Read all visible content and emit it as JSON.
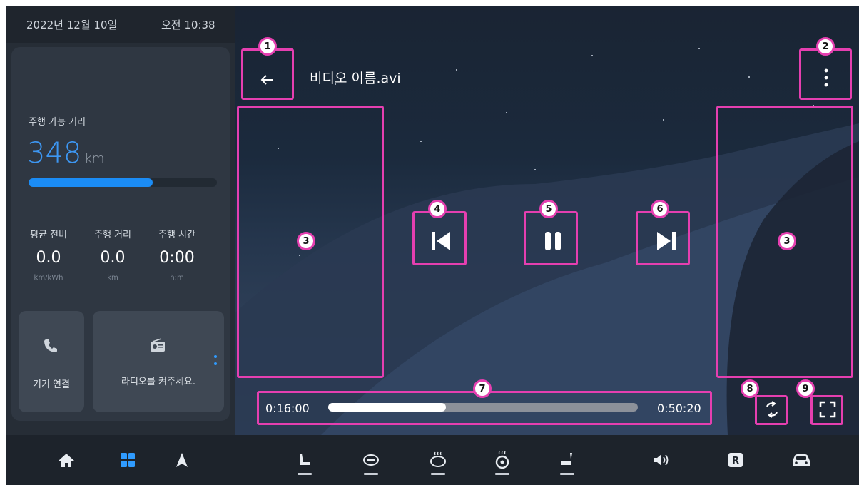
{
  "status_bar": {
    "date": "2022년 12월 10일",
    "time": "오전 10:38",
    "icons": [
      "user-icon",
      "usb-icon",
      "bell-icon",
      "bluetooth-icon",
      "wifi-icon",
      "signal-icon",
      "battery-icon"
    ]
  },
  "range": {
    "label": "주행 가능 거리",
    "value": "348",
    "unit": "km",
    "fill_fraction": 0.66
  },
  "stats": [
    {
      "title": "평균 전비",
      "value": "0.0",
      "unit": "km/kWh"
    },
    {
      "title": "주행 거리",
      "value": "0.0",
      "unit": "km"
    },
    {
      "title": "주행 시간",
      "value": "0:00",
      "unit": "h:m"
    }
  ],
  "cards": {
    "device_connect": "기기 연결",
    "radio": "라디오를 켜주세요."
  },
  "player": {
    "title": "비디오 이름.avi",
    "current_time": "0:16:00",
    "total_time": "0:50:20",
    "progress_fraction": 0.38
  },
  "badges": [
    "1",
    "2",
    "3",
    "3",
    "4",
    "5",
    "6",
    "7",
    "8",
    "9"
  ],
  "colors": {
    "accent_blue": "#1b8cf5",
    "highlight_pink": "#e53fb0",
    "range_text": "#3d97f3",
    "nav_active": "#2f9bff"
  },
  "nav_icons": [
    "home-icon",
    "apps-icon",
    "navigation-icon",
    "seat-icon",
    "steering-heat-icon",
    "seat-heat-icon",
    "steering-wheel-heat-icon",
    "seat-vent-icon",
    "volume-icon",
    "rear-camera-icon",
    "car-icon"
  ]
}
